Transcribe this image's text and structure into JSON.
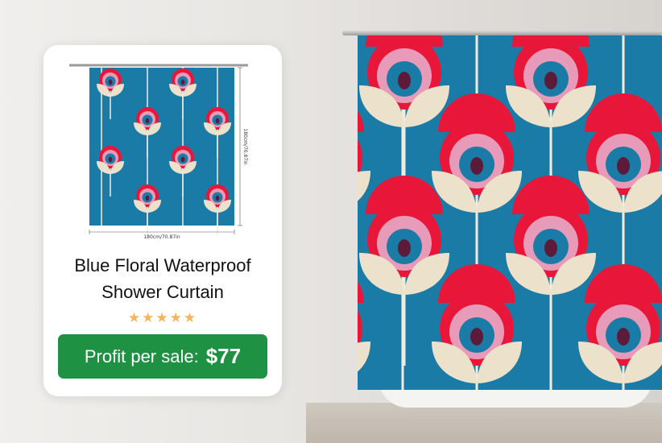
{
  "product": {
    "title_line1": "Blue Floral Waterproof",
    "title_line2": "Shower Curtain",
    "rating_stars": 5,
    "stars_text": "★★★★★",
    "width_label": "180cm/70.87in",
    "height_label": "180cm/70.87in"
  },
  "profit": {
    "label": "Profit per sale:",
    "amount": "$77"
  },
  "colors": {
    "curtain_blue": "#1a7ca6",
    "flower_red": "#e8173a",
    "flower_pink": "#e89bb8",
    "flower_center": "#5d1b3a",
    "petal_cream": "#ece2cc",
    "profit_green": "#1e9142",
    "star_gold": "#f5b45e"
  },
  "icons": {
    "rating": "star-icon"
  }
}
